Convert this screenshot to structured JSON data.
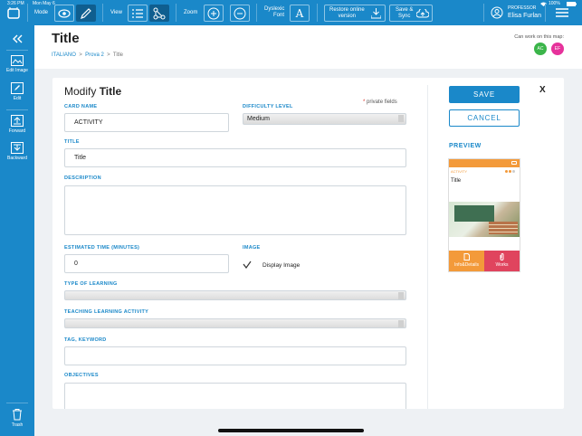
{
  "status": {
    "time": "3:26 PM",
    "date": "Mon May 6",
    "battery": "100%"
  },
  "toolbar": {
    "mode_label": "Mode",
    "view_label": "View",
    "zoom_label": "Zoom",
    "dyslexic_label_1": "Dyslexic",
    "dyslexic_label_2": "Font",
    "restore_label_1": "Restore online",
    "restore_label_2": "version",
    "save_sync_label_1": "Save &",
    "save_sync_label_2": "Sync",
    "user_role": "PROFESSOR",
    "user_name": "Elisa Furlan"
  },
  "sidebar": {
    "edit_image": "Edit Image",
    "edit": "Edit",
    "forward": "Forward",
    "backward": "Backward",
    "trash": "Trash"
  },
  "header": {
    "title": "Title",
    "breadcrumb": [
      "ITALIANO",
      ">",
      "Prova 2",
      ">",
      "Title"
    ],
    "can_work": "Can work on this map:",
    "avatars": [
      {
        "initials": "AC",
        "color": "#3bb54a"
      },
      {
        "initials": "EF",
        "color": "#e6329b"
      }
    ]
  },
  "form": {
    "heading_prefix": "Modify",
    "heading_title": "Title",
    "private_star": "*",
    "private_text": "private fields",
    "card_name_label": "CARD NAME",
    "card_name_value": "ACTIVITY",
    "difficulty_label": "DIFFICULTY LEVEL",
    "difficulty_value": "Medium",
    "title_label": "TITLE",
    "title_value": "Title",
    "description_label": "DESCRIPTION",
    "description_value": "",
    "time_label": "ESTIMATED TIME (MINUTES)",
    "time_value": "0",
    "image_label": "IMAGE",
    "display_image_label": "Display Image",
    "type_learning_label": "TYPE OF LEARNING",
    "tla_label": "TEACHING LEARNING ACTIVITY",
    "tag_label": "TAG, KEYWORD",
    "objectives_label": "OBJECTIVES"
  },
  "actions": {
    "save": "SAVE",
    "cancel": "CANCEL",
    "close": "X"
  },
  "preview": {
    "label": "PREVIEW",
    "card_activity": "ACTIVITY",
    "card_title": "Title",
    "info_btn": "Info&Details",
    "works_btn": "Works"
  }
}
